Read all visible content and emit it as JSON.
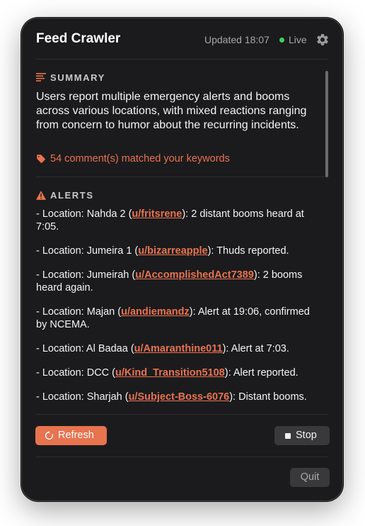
{
  "window": {
    "title": "Feed Crawler",
    "updated": "Updated 18:07",
    "live": "Live",
    "live_color": "#3fcf62",
    "accent": "#e8734f"
  },
  "summary": {
    "heading": "SUMMARY",
    "text": "Users report multiple emergency alerts and booms across various locations, with mixed reactions ranging from concern to humor about the recurring incidents.",
    "matched": "54 comment(s) matched your keywords"
  },
  "alerts": {
    "heading": "ALERTS",
    "items": [
      {
        "prefix": "- Location: Nahda 2 (",
        "user": "u/fritsrene",
        "suffix": "): 2 distant booms heard at 7:05."
      },
      {
        "prefix": "- Location: Jumeira 1 (",
        "user": "u/bizarreapple",
        "suffix": "): Thuds reported."
      },
      {
        "prefix": "- Location: Jumeirah (",
        "user": "u/AccomplishedAct7389",
        "suffix": "): 2 booms heard again."
      },
      {
        "prefix": "- Location: Majan (",
        "user": "u/andiemandz",
        "suffix": "): Alert at 19:06, confirmed by NCEMA."
      },
      {
        "prefix": "- Location: Al Badaa (",
        "user": "u/Amaranthine011",
        "suffix": "): Alert at 7:03."
      },
      {
        "prefix": "- Location: DCC (",
        "user": "u/Kind_Transition5108",
        "suffix": "): Alert reported."
      },
      {
        "prefix": "- Location: Sharjah (",
        "user": "u/Subject-Boss-6076",
        "suffix": "): Distant booms."
      }
    ]
  },
  "footer": {
    "refresh_label": "Refresh",
    "stop_label": "Stop",
    "quit_label": "Quit"
  },
  "icons": {
    "settings": "gear-icon",
    "summary": "lines-icon",
    "matched": "tag-icon",
    "alerts": "warning-icon",
    "refresh": "refresh-icon",
    "stop": "stop-icon"
  }
}
